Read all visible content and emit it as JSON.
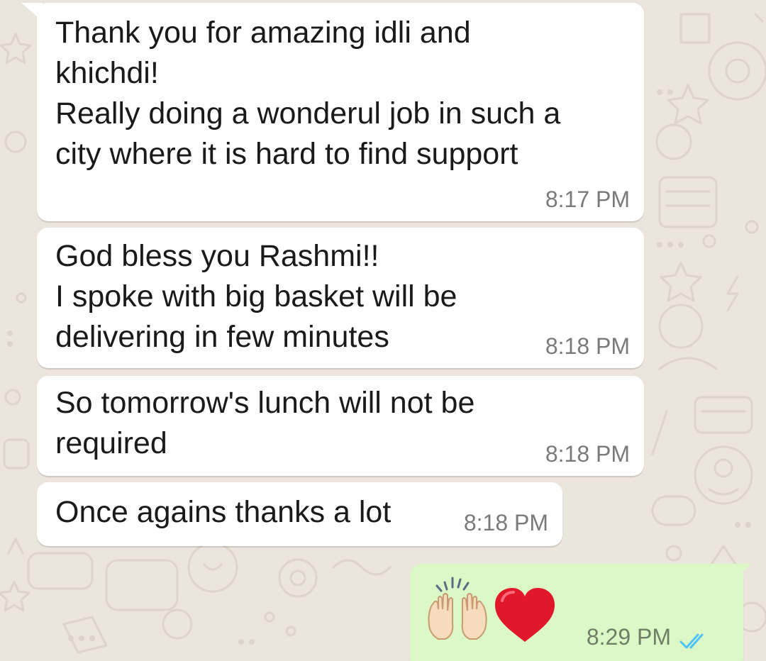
{
  "theme": {
    "wallpaper_color": "#ece5dd",
    "incoming_bubble_color": "#ffffff",
    "outgoing_bubble_color": "#dcf8c6",
    "read_tick_color": "#4fc3f7"
  },
  "messages": [
    {
      "direction": "incoming",
      "text": "Thank you for amazing idli and\nkhichdi!\nReally doing a wonderul job in such a\ncity where it is hard to find support",
      "time": "8:17 PM"
    },
    {
      "direction": "incoming",
      "text": "God bless you Rashmi!!\nI spoke with big basket will be\ndelivering in few minutes",
      "time": "8:18 PM"
    },
    {
      "direction": "incoming",
      "text": "So tomorrow's lunch will not be\nrequired",
      "time": "8:18 PM"
    },
    {
      "direction": "incoming",
      "text": "Once agains thanks a lot",
      "time": "8:18 PM"
    },
    {
      "direction": "outgoing",
      "emojis": [
        "raising-hands-emoji",
        "red-heart-emoji"
      ],
      "time": "8:29 PM",
      "status": "read-double-check-icon"
    }
  ]
}
